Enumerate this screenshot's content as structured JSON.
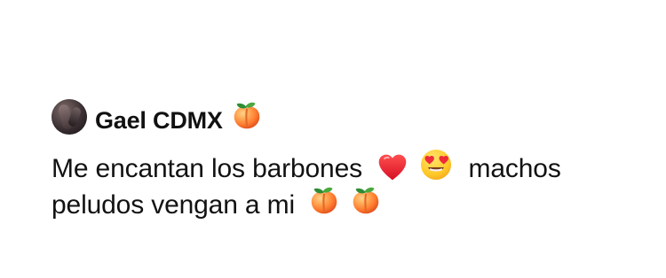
{
  "post": {
    "username": "Gael CDMX",
    "text_line_1_part_1": "Me encantan los barbones",
    "text_line_1_part_2": "machos",
    "text_line_2": "peludos vengan a mi",
    "emojis": {
      "peach": "peach-icon",
      "heart": "red-heart-icon",
      "heart_eyes": "heart-eyes-face-icon"
    },
    "colors": {
      "text": "#121212",
      "background": "#ffffff",
      "heart": "#ef1f2d",
      "peach": "#ff9b45"
    }
  }
}
